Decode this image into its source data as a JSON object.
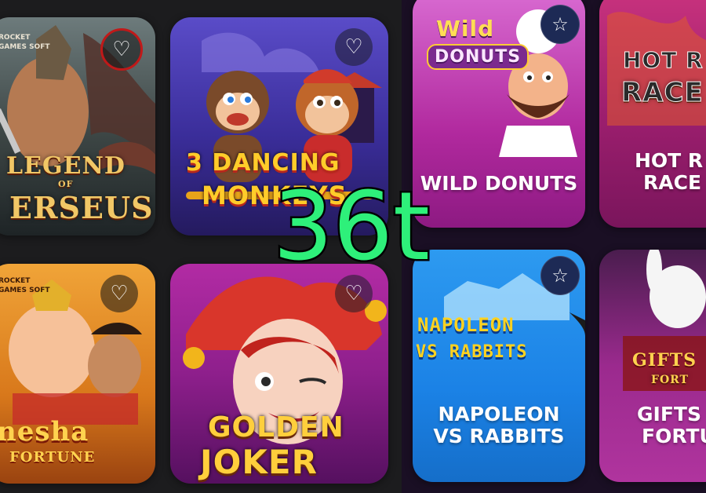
{
  "watermark": "36t",
  "games": [
    {
      "id": "legend-of-perseus",
      "title_line1": "LEGEND",
      "title_of": "OF",
      "title_line2": "ERSEUS",
      "corner_text": "ROCKET GAMES SOFT",
      "favorite": false,
      "accent": "#e6b14d"
    },
    {
      "id": "3-dancing-monkeys",
      "title_line1": "3 DANCING",
      "title_line2": "MONKEYS",
      "favorite": false,
      "accent": "#ffb400"
    },
    {
      "id": "wild-donuts",
      "logo_line1": "Wild",
      "logo_line2": "DONUTS",
      "label": "WILD DONUTS",
      "favorite": false
    },
    {
      "id": "hot-rod-racer",
      "logo_line1": "HOT R",
      "logo_line2": "RACE",
      "label_line1": "HOT R",
      "label_line2": "RACE",
      "favorite": false
    },
    {
      "id": "ganesha-fortune",
      "title_line1": "nesha",
      "title_line2": "FORTUNE",
      "corner_text": "ROCKET GAMES SOFT",
      "favorite": false
    },
    {
      "id": "golden-joker",
      "title_line1": "GOLDEN",
      "title_line2": "JOKER",
      "favorite": false
    },
    {
      "id": "napoleon-vs-rabbits",
      "logo_line1": "NAPOLEON",
      "logo_line2": "VS RABBITS",
      "label_line1": "NAPOLEON",
      "label_line2": "VS RABBITS",
      "favorite": false
    },
    {
      "id": "gifts-of-fortune",
      "logo_line1": "GIFTS",
      "logo_line2": "FORT",
      "label_line1": "GIFTS",
      "label_line2": "FORTU",
      "favorite": false
    }
  ],
  "icons": {
    "heart": "♡",
    "star": "☆"
  }
}
